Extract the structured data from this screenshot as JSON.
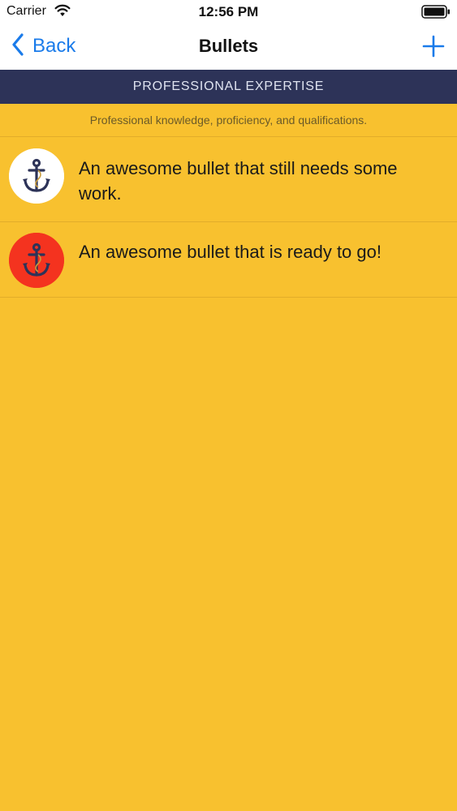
{
  "status_bar": {
    "carrier": "Carrier",
    "time": "12:56 PM"
  },
  "nav": {
    "back_label": "Back",
    "title": "Bullets",
    "add_icon": "plus-icon",
    "back_icon": "chevron-left-icon"
  },
  "section": {
    "header": "PROFESSIONAL EXPERTISE",
    "subtitle": "Professional knowledge, proficiency, and qualifications."
  },
  "bullets": [
    {
      "text": "An awesome bullet that still needs some work.",
      "icon": "anchor-icon",
      "icon_background": "#ffffff"
    },
    {
      "text": "An awesome bullet that is ready to go!",
      "icon": "anchor-icon",
      "icon_background": "#f4331f"
    }
  ],
  "colors": {
    "accent": "#1a7bea",
    "background": "#f8c12f",
    "header_bg": "#2d3358"
  }
}
